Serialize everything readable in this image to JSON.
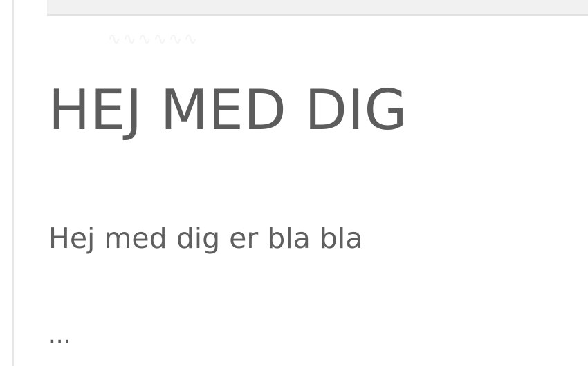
{
  "page": {
    "title": "HEJ MED DIG",
    "subtitle": "Hej med dig er bla bla",
    "ellipsis": "..."
  },
  "colors": {
    "text": "#5a5a5a",
    "border": "#e6e6e6",
    "topbar": "#f1f1f1"
  }
}
